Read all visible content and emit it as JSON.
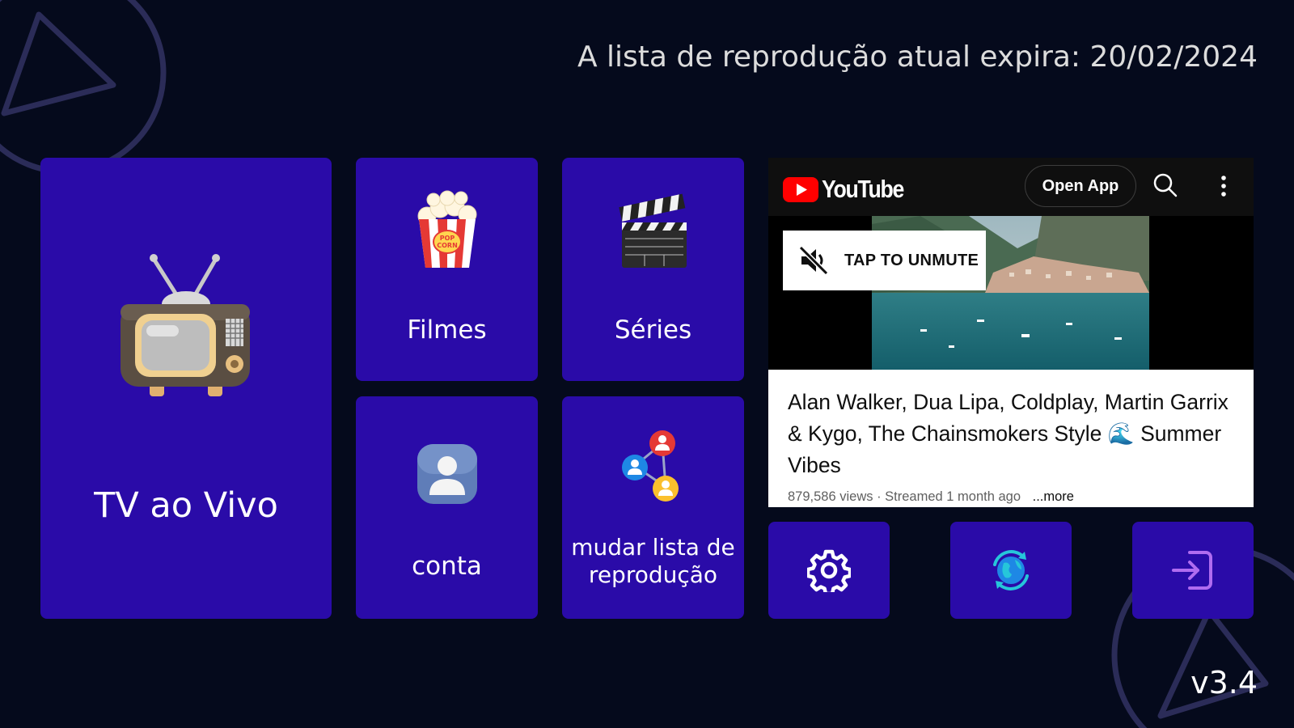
{
  "header": {
    "expiry_text": "A lista de reprodução atual expira: 20/02/2024"
  },
  "tiles": {
    "live_tv": {
      "label": "TV ao Vivo",
      "icon": "retro-tv-icon"
    },
    "movies": {
      "label": "Filmes",
      "icon": "popcorn-icon"
    },
    "series": {
      "label": "Séries",
      "icon": "clapperboard-icon"
    },
    "account": {
      "label": "conta",
      "icon": "user-icon"
    },
    "change_playlist": {
      "label_line1": "mudar lista de",
      "label_line2": "reprodução",
      "icon": "network-users-icon"
    }
  },
  "actions": [
    {
      "icon": "gear-icon"
    },
    {
      "icon": "globe-refresh-icon"
    },
    {
      "icon": "logout-icon"
    }
  ],
  "youtube": {
    "logo_text": "YouTube",
    "open_app_label": "Open App",
    "unmute_label": "TAP TO UNMUTE",
    "video_title": "Alan Walker, Dua Lipa, Coldplay, Martin Garrix & Kygo, The Chainsmokers Style 🌊 Summer Vibes",
    "meta": "879,586 views · Streamed 1 month ago",
    "more_label": "...more"
  },
  "footer": {
    "version": "v3.4"
  },
  "colors": {
    "background": "#050a1c",
    "tile": "#2a0ba8",
    "youtube_red": "#ff0000"
  }
}
